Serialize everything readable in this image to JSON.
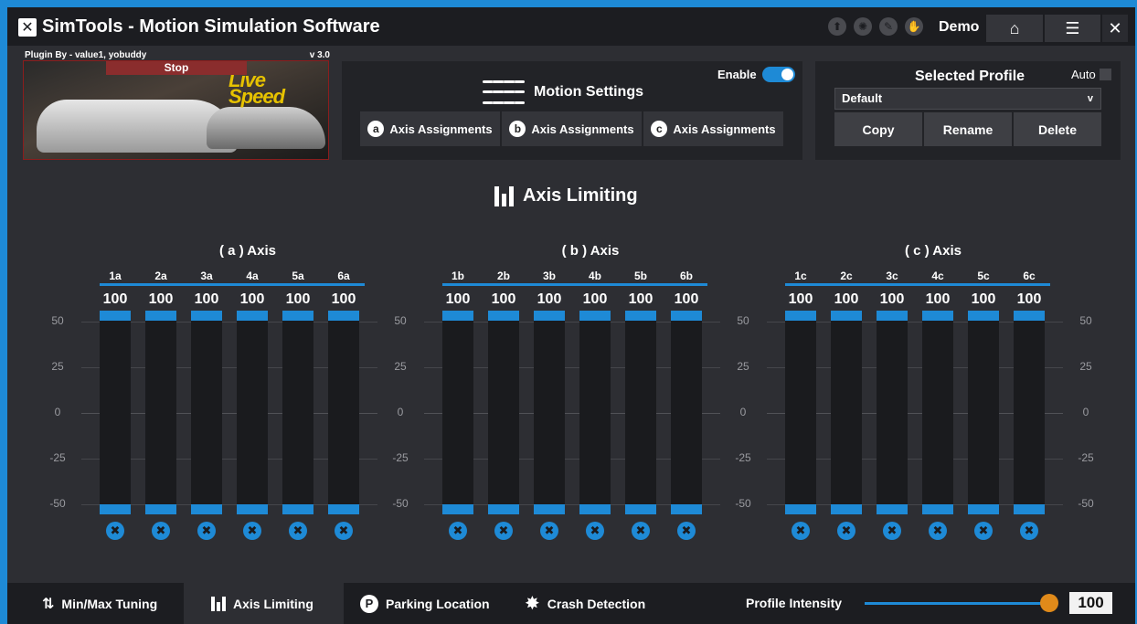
{
  "app": {
    "title": "SimTools - Motion Simulation Software",
    "logo_glyph": "✕",
    "mode": "Demo",
    "title_icons": [
      "upload-icon",
      "settings-burst-icon",
      "pen-icon",
      "hand-icon"
    ],
    "title_icon_glyphs": [
      "⬆",
      "✺",
      "✎",
      "✋"
    ],
    "home_glyph": "⌂",
    "menu_glyph": "☰",
    "close_glyph": "✕"
  },
  "plugin": {
    "author": "Plugin By - value1, yobuddy",
    "version": "v 3.0",
    "stop_label": "Stop",
    "game_logo_line1": "Live",
    "game_logo_line2": "Speed"
  },
  "motion": {
    "title": "Motion Settings",
    "enable_label": "Enable",
    "enabled": true,
    "axis_buttons": [
      {
        "letter": "a",
        "label": "Axis Assignments"
      },
      {
        "letter": "b",
        "label": "Axis Assignments"
      },
      {
        "letter": "c",
        "label": "Axis Assignments"
      }
    ]
  },
  "profile": {
    "title": "Selected Profile",
    "auto_label": "Auto",
    "selected": "Default",
    "chevron": "v",
    "copy_label": "Copy",
    "rename_label": "Rename",
    "delete_label": "Delete"
  },
  "limiting": {
    "title": "Axis Limiting",
    "ticks": [
      "50",
      "25",
      "0",
      "-25",
      "-50"
    ],
    "groups": [
      {
        "title": "( a ) Axis",
        "columns": [
          {
            "label": "1a",
            "value": "100"
          },
          {
            "label": "2a",
            "value": "100"
          },
          {
            "label": "3a",
            "value": "100"
          },
          {
            "label": "4a",
            "value": "100"
          },
          {
            "label": "5a",
            "value": "100"
          },
          {
            "label": "6a",
            "value": "100"
          }
        ]
      },
      {
        "title": "( b ) Axis",
        "columns": [
          {
            "label": "1b",
            "value": "100"
          },
          {
            "label": "2b",
            "value": "100"
          },
          {
            "label": "3b",
            "value": "100"
          },
          {
            "label": "4b",
            "value": "100"
          },
          {
            "label": "5b",
            "value": "100"
          },
          {
            "label": "6b",
            "value": "100"
          }
        ]
      },
      {
        "title": "( c ) Axis",
        "columns": [
          {
            "label": "1c",
            "value": "100"
          },
          {
            "label": "2c",
            "value": "100"
          },
          {
            "label": "3c",
            "value": "100"
          },
          {
            "label": "4c",
            "value": "100"
          },
          {
            "label": "5c",
            "value": "100"
          },
          {
            "label": "6c",
            "value": "100"
          }
        ]
      }
    ],
    "reset_glyph": "✖"
  },
  "nav": {
    "tabs": [
      {
        "label": "Min/Max Tuning",
        "icon": "up-down-arrows-icon",
        "glyph": "⇅",
        "active": false
      },
      {
        "label": "Axis Limiting",
        "icon": "bars-icon",
        "glyph": "▮",
        "active": true
      },
      {
        "label": "Parking Location",
        "icon": "parking-icon",
        "glyph": "P",
        "active": false
      },
      {
        "label": "Crash Detection",
        "icon": "crash-burst-icon",
        "glyph": "✸",
        "active": false
      }
    ],
    "intensity_label": "Profile Intensity",
    "intensity_value": "100"
  },
  "colors": {
    "accent": "#1e8ad6",
    "knob": "#e08a1a",
    "panel": "#222327",
    "background": "#2d2e33"
  }
}
